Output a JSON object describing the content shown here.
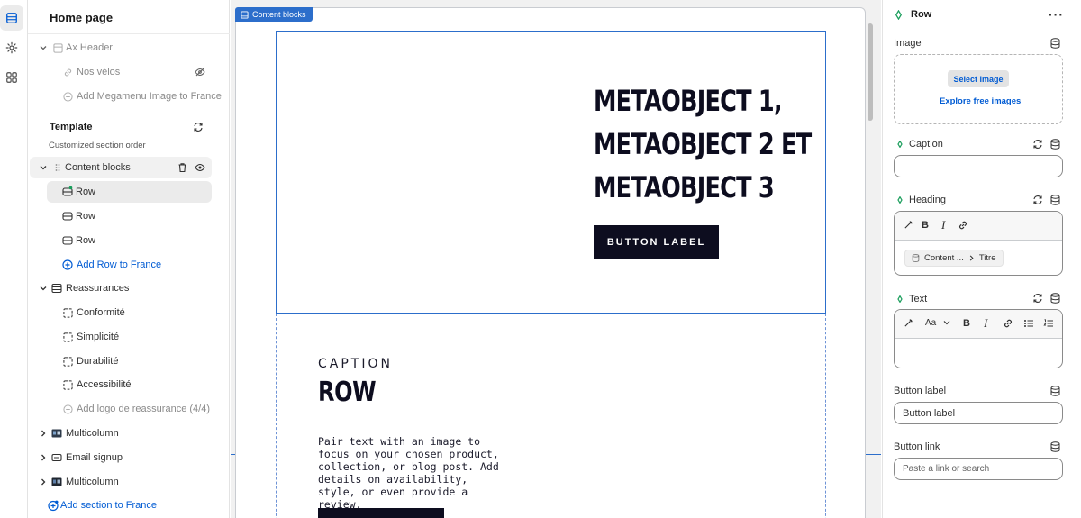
{
  "sidebar": {
    "title": "Home page",
    "header_group": {
      "name": "Ax Header",
      "items": [
        {
          "label": "Nos vélos"
        },
        {
          "label": "Add Megamenu Image to France"
        }
      ]
    },
    "template": {
      "title": "Template",
      "subtitle": "Customized section order"
    },
    "content_blocks": {
      "label": "Content blocks",
      "rows": [
        {
          "label": "Row"
        },
        {
          "label": "Row"
        },
        {
          "label": "Row"
        }
      ],
      "add_label": "Add Row to France"
    },
    "reassurances": {
      "label": "Reassurances",
      "items": [
        {
          "label": "Conformité"
        },
        {
          "label": "Simplicité"
        },
        {
          "label": "Durabilité"
        },
        {
          "label": "Accessibilité"
        }
      ],
      "add_label": "Add logo de reassurance (4/4)"
    },
    "sections": [
      {
        "label": "Multicolumn"
      },
      {
        "label": "Email signup"
      },
      {
        "label": "Multicolumn"
      }
    ],
    "add_section_label": "Add section to France"
  },
  "canvas": {
    "frame_tag": "Content blocks",
    "block1": {
      "heading_lines": [
        "METAOBJECT 1,",
        "METAOBJECT 2 ET",
        "METAOBJECT 3"
      ],
      "button_label": "BUTTON LABEL"
    },
    "block2": {
      "caption": "CAPTION",
      "title": "ROW",
      "text": "Pair text with an image to focus on your chosen product, collection, or blog post. Add details on availability, style, or even provide a review."
    }
  },
  "panel": {
    "title": "Row",
    "image_label": "Image",
    "select_image": "Select image",
    "explore_free": "Explore free images",
    "caption_label": "Caption",
    "caption_value": "",
    "heading_label": "Heading",
    "heading_chip_source": "Content ...",
    "heading_chip_field": "Titre",
    "text_label": "Text",
    "button_label_label": "Button label",
    "button_label_value": "Button label",
    "button_link_label": "Button link",
    "button_link_placeholder": "Paste a link or search"
  },
  "colors": {
    "accent": "#2c6ecb",
    "link": "#005bd3",
    "dark_button": "#0d0d1f",
    "dynamic_dot": "#1a9e5c"
  }
}
